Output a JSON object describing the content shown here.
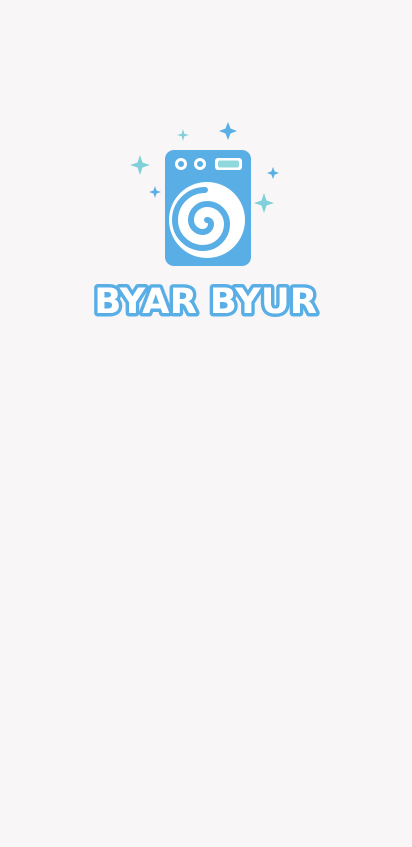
{
  "splash": {
    "brand_name": "BYAR BYUR",
    "colors": {
      "background": "#f8f6f6",
      "brand_blue": "#5aaee6",
      "sparkle_teal": "#7fd0d8",
      "sparkle_blue": "#5aaee6",
      "display_teal": "#8fd8dc",
      "white": "#ffffff"
    },
    "icons": [
      "washing-machine-icon",
      "sparkle-icon",
      "spiral-icon"
    ]
  }
}
